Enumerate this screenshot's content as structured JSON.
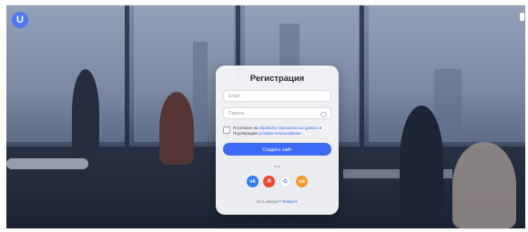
{
  "app": {
    "logo_letter": "U"
  },
  "form": {
    "title": "Регистрация",
    "email_placeholder": "Email",
    "password_placeholder": "Пароль",
    "agree_text_1": "Я согласен на ",
    "agree_link_1": "обработку персональных данных",
    "agree_text_2": " и Подтверждаю ",
    "agree_link_2": "условия использования",
    "submit_label": "Создать сайт",
    "or_label": "или",
    "socials": [
      {
        "name": "vk",
        "glyph": "vk"
      },
      {
        "name": "yandex",
        "glyph": "Я"
      },
      {
        "name": "google",
        "glyph": "G"
      },
      {
        "name": "odnoklassniki",
        "glyph": "ок"
      }
    ],
    "account_text": "Есть аккаунт?",
    "login_link": "Войдите"
  },
  "colors": {
    "accent": "#3d6af5",
    "logo": "#4f76f5"
  }
}
